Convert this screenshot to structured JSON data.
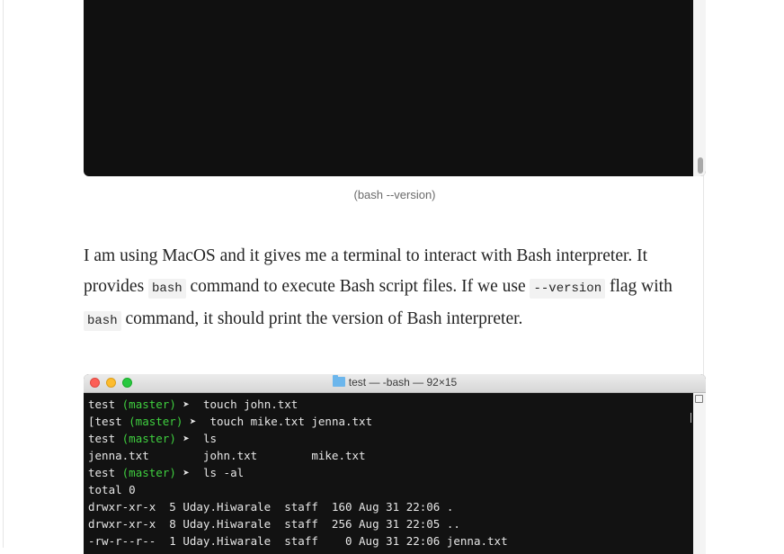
{
  "figure1": {
    "caption": "(bash --version)"
  },
  "paragraph": {
    "part1": "I am using MacOS and it gives me a terminal to interact with Bash interpreter. It provides ",
    "code1": "bash",
    "part2": " command to execute Bash script files. If we use ",
    "code2": "--version",
    "part3": " flag with ",
    "code3": "bash",
    "part4": " command, it should print the version of Bash interpreter."
  },
  "terminal": {
    "window_title": "test — -bash — 92×15",
    "lines": [
      {
        "prefix": "test ",
        "branch": "(master)",
        "prompt": " ➤  ",
        "text": "touch john.txt"
      },
      {
        "prefix": "[test ",
        "branch": "(master)",
        "prompt": " ➤  ",
        "text": "touch mike.txt jenna.txt"
      },
      {
        "prefix": "test ",
        "branch": "(master)",
        "prompt": " ➤  ",
        "text": "ls"
      },
      {
        "prefix": "",
        "branch": "",
        "prompt": "",
        "text": "jenna.txt        john.txt        mike.txt"
      },
      {
        "prefix": "test ",
        "branch": "(master)",
        "prompt": " ➤  ",
        "text": "ls -al"
      },
      {
        "prefix": "",
        "branch": "",
        "prompt": "",
        "text": "total 0"
      },
      {
        "prefix": "",
        "branch": "",
        "prompt": "",
        "text": "drwxr-xr-x  5 Uday.Hiwarale  staff  160 Aug 31 22:06 ."
      },
      {
        "prefix": "",
        "branch": "",
        "prompt": "",
        "text": "drwxr-xr-x  8 Uday.Hiwarale  staff  256 Aug 31 22:05 .."
      },
      {
        "prefix": "",
        "branch": "",
        "prompt": "",
        "text": "-rw-r--r--  1 Uday.Hiwarale  staff    0 Aug 31 22:06 jenna.txt"
      }
    ]
  }
}
